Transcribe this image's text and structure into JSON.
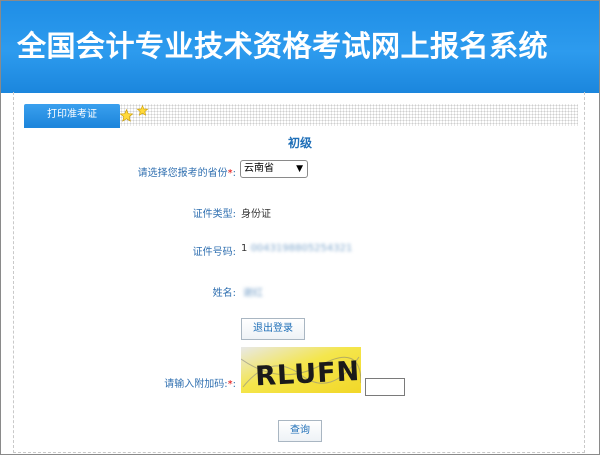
{
  "header": {
    "title": "全国会计专业技术资格考试网上报名系统"
  },
  "tabs": [
    {
      "label": "打印准考证",
      "active": true
    }
  ],
  "level_title": "初级",
  "form": {
    "province": {
      "label": "请选择您报考的省份",
      "required_mark": "*",
      "colon": ":",
      "selected": "云南省"
    },
    "id_type": {
      "label": "证件类型:",
      "value": "身份证"
    },
    "id_number": {
      "label": "证件号码:",
      "value": "1",
      "value_obscured": "0043198805254321"
    },
    "name": {
      "label": "姓名:",
      "value_obscured": "谢红"
    },
    "logout_button": "退出登录",
    "captcha": {
      "label": "请输入附加码:",
      "required_mark": "*",
      "colon": ":",
      "text": "RLUFN"
    },
    "query_button": "查询"
  },
  "colors": {
    "banner": "#2a96ea",
    "label": "#2f6fb0",
    "required": "#e00000",
    "captcha_bg": "#f2e14a"
  }
}
